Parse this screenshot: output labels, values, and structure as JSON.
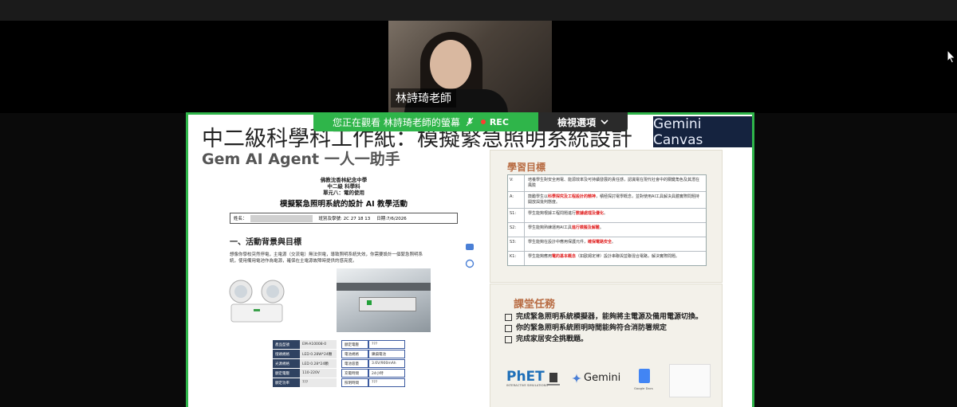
{
  "participant": {
    "name": "林詩琦老師"
  },
  "share_bar": {
    "message": "您正在觀看 林詩琦老師的螢幕",
    "rec": "REC",
    "view_options": "檢視選項"
  },
  "slide": {
    "title": "中二級科學科工作紙：模擬緊急照明系統設計",
    "subtitle": "Gem AI Agent 一人一助手",
    "brand": "Gemini Canvas",
    "worksheet": {
      "school": "佛教沈香林紀念中學",
      "grade": "中二級 科學科",
      "unit": "單元八：電的使用",
      "title": "模擬緊急照明系統的設計 AI 教學活動",
      "name_label": "姓名：",
      "class_label": "班別及學號: 2C 27 18 13",
      "date_label": "日期:7/6/2026",
      "section": "一、活動背景與目標",
      "paragraph": "想像你學校突然停電，主電源（交流電）無法供電，導致照明系統失效，你需要設計一個緊急照明系統，使用備用電池作為電源，確保在主電源故障時提供的感亮度。",
      "specs": [
        [
          "產品型號",
          "EM-A10008-0",
          "額定電壓",
          "???"
        ],
        [
          "燈頭規格",
          "LED 0.28W*24顆",
          "電池規格",
          "鎳鎘電池"
        ],
        [
          "光源規格",
          "LED 0.28*24顆",
          "電池容量",
          "3.6V/900mAh"
        ],
        [
          "額定電壓",
          "110-220V",
          "充電時間",
          "24小時"
        ],
        [
          "額定功率",
          "???",
          "照明時間",
          "???"
        ]
      ]
    },
    "learning": {
      "heading": "學習目標",
      "rows": [
        {
          "code": "V:",
          "text": "培養學生對安全用電、能源效率及可持續發展的責任感，認識電在現代社會中的關鍵角色及其潛在風險",
          "hl": ""
        },
        {
          "code": "A:",
          "text": "鼓勵學生以",
          "hl": "科學探究及工程設計的精神",
          "text2": "，積極探討電學概念，並對使用AI工具解決具體實際問題持開放與批判態度。"
        },
        {
          "code": "S1:",
          "text": "學生能夠根據工程問題進行",
          "hl": "數據處理及優化",
          "text2": "。"
        },
        {
          "code": "S2:",
          "text": "學生能夠熟練運用AI工具",
          "hl": "進行模擬及解難",
          "text2": "。"
        },
        {
          "code": "S3:",
          "text": "學生能夠在設計中應用保護元件，",
          "hl": "確保電路安全",
          "text2": "。"
        },
        {
          "code": "K1:",
          "text": "學生能夠應用",
          "hl": "電的基本概念",
          "text2": "（如歐姆定律）設計串聯與並聯混合電路，解決實際問題。"
        }
      ]
    },
    "tasks": {
      "heading": "課堂任務",
      "items": [
        "完成緊急照明系統模擬器，能夠將主電源及備用電源切換。",
        "你的緊急照明系統照明時間能夠符合消防署規定",
        "完成家居安全挑戰題。"
      ],
      "logos": {
        "phet": "PhET",
        "phet_sub": "INTERACTIVE SIMULATIONS",
        "gemini": "Gemini",
        "gdocs": "Google Docs"
      }
    }
  },
  "colors": {
    "accent": "#2fb54a",
    "brand_bg": "#15233f",
    "heading": "#b86c43",
    "highlight": "#e02020"
  }
}
